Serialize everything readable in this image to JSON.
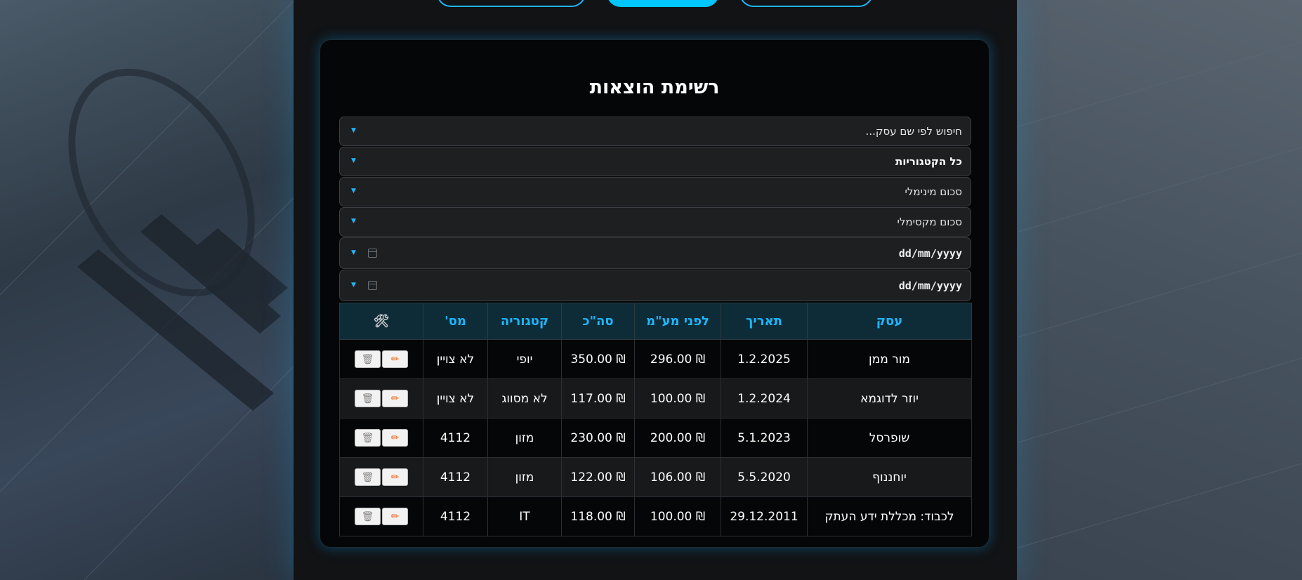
{
  "title": "רשימת הוצאות",
  "filters": {
    "search_placeholder": "חיפוש לפי שם עסק...",
    "category_selected": "כל הקטגוריות",
    "min_amount_placeholder": "סכום מינימלי",
    "max_amount_placeholder": "סכום מקסימלי",
    "date_from": "dd/mm/yyyy",
    "date_to": "dd/mm/yyyy"
  },
  "table": {
    "headers": {
      "business": "עסק",
      "date": "תאריך",
      "before_vat": "לפני מע\"מ",
      "total": "סה\"כ",
      "category": "קטגוריה",
      "tax": "מס'",
      "actions_icon": "tools-icon"
    },
    "rows": [
      {
        "business": "מור ממן",
        "date": "1.2.2025",
        "before_vat": "₪ 296.00",
        "total": "₪ 350.00",
        "category": "יופי",
        "tax": "לא צויין"
      },
      {
        "business": "יוזר לדוגמא",
        "date": "1.2.2024",
        "before_vat": "₪ 100.00",
        "total": "₪ 117.00",
        "category": "לא מסווג",
        "tax": "לא צויין"
      },
      {
        "business": "שופרסל",
        "date": "5.1.2023",
        "before_vat": "₪ 200.00",
        "total": "₪ 230.00",
        "category": "מזון",
        "tax": "4112"
      },
      {
        "business": "יוחננוף",
        "date": "5.5.2020",
        "before_vat": "₪ 106.00",
        "total": "₪ 122.00",
        "category": "מזון",
        "tax": "4112"
      },
      {
        "business": "לכבוד: מכללת ידע העתק",
        "date": "29.12.2011",
        "before_vat": "₪ 100.00",
        "total": "₪ 118.00",
        "category": "IT",
        "tax": "4112"
      }
    ]
  },
  "colors": {
    "accent": "#1fb6ff",
    "header_bg": "#0e2c38",
    "edit_icon": "#f06a1c"
  }
}
